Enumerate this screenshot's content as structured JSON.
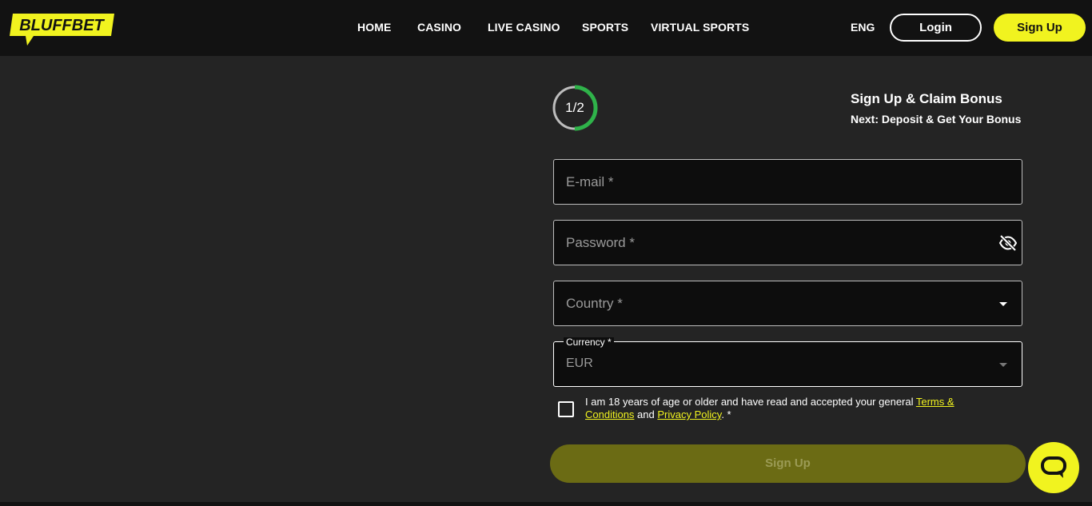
{
  "brand": {
    "logo_text": "BLUFFBET",
    "accent_color": "#f1f31f",
    "header_bg": "#121212",
    "page_bg": "#242424"
  },
  "nav": {
    "items": [
      {
        "label": "HOME"
      },
      {
        "label": "CASINO"
      },
      {
        "label": "LIVE CASINO"
      },
      {
        "label": "SPORTS"
      },
      {
        "label": "VIRTUAL SPORTS"
      }
    ],
    "language": "ENG",
    "login_label": "Login",
    "signup_label": "Sign Up"
  },
  "progress": {
    "label": "1/2",
    "fraction": 0.5,
    "ring_color": "#2fb34a"
  },
  "step": {
    "title": "Sign Up & Claim Bonus",
    "next": "Next: Deposit & Get Your Bonus"
  },
  "form": {
    "email_placeholder": "E-mail *",
    "email_value": "",
    "password_placeholder": "Password *",
    "password_value": "",
    "password_toggle_icon": "eye-off-icon",
    "country_placeholder": "Country *",
    "currency_label": "Currency *",
    "currency_value": "EUR",
    "consent_prefix": "I am 18 years of age or older and have read and accepted your general ",
    "terms_link": "Terms & Conditions",
    "consent_and": " and ",
    "privacy_link": "Privacy Policy",
    "consent_suffix": ". *",
    "consent_checked": false,
    "submit_label": "Sign Up"
  },
  "chat": {
    "icon": "chat-bubble-icon"
  }
}
